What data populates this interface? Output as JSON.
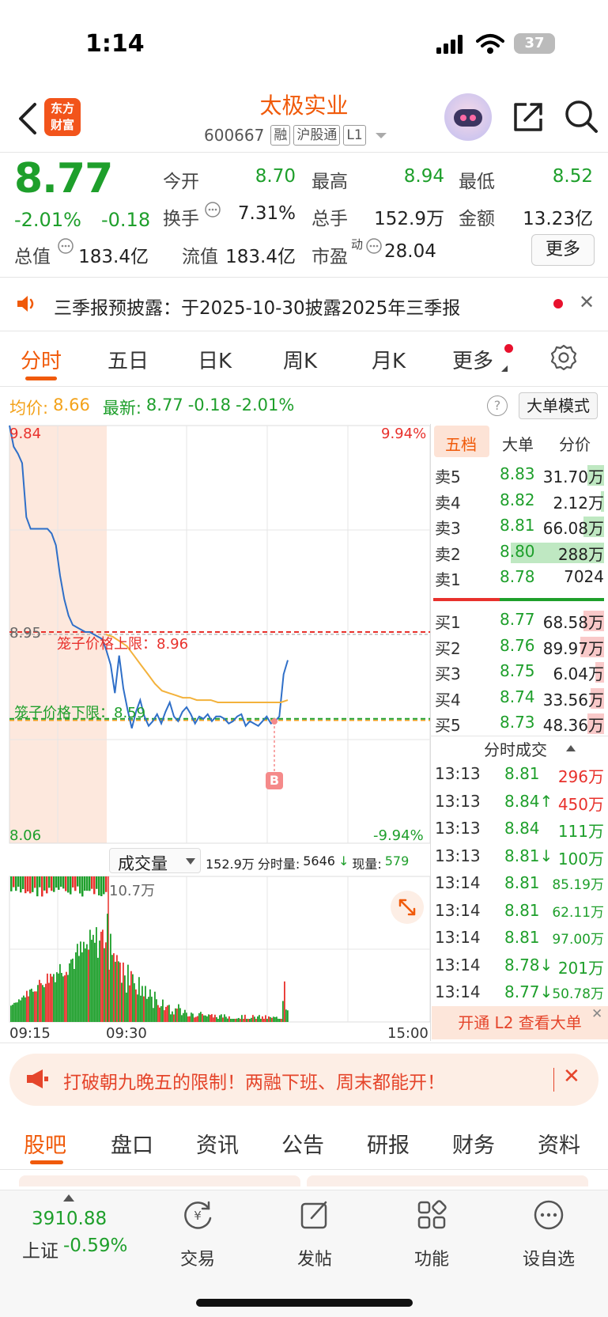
{
  "status": {
    "time": "1:14",
    "battery": "37"
  },
  "header": {
    "logo_line1": "东方",
    "logo_line2": "财富",
    "stock_name": "太极实业",
    "stock_code": "600667",
    "tags": [
      "融",
      "沪股通",
      "L1"
    ]
  },
  "quote": {
    "price": "8.77",
    "change_pct": "-2.01%",
    "change_amt": "-0.18",
    "fields": [
      {
        "label": "今开",
        "value": "8.70",
        "color": "#1e9f2b"
      },
      {
        "label": "最高",
        "value": "8.94",
        "color": "#1e9f2b"
      },
      {
        "label": "最低",
        "value": "8.52",
        "color": "#1e9f2b"
      },
      {
        "label": "换手",
        "value": "7.31%",
        "color": "#222222"
      },
      {
        "label": "总手",
        "value": "152.9万",
        "color": "#222222"
      },
      {
        "label": "金额",
        "value": "13.23亿",
        "color": "#222222"
      },
      {
        "label": "总值",
        "value": "183.4亿",
        "color": "#222222"
      },
      {
        "label": "流值",
        "value": "183.4亿",
        "color": "#222222"
      },
      {
        "label": "市盈",
        "sup": "动",
        "value": "28.04",
        "color": "#222222"
      }
    ],
    "more_label": "更多"
  },
  "notice": {
    "text": "三季报预披露：于2025-10-30披露2025年三季报"
  },
  "chart_tabs": [
    "分时",
    "五日",
    "日K",
    "周K",
    "月K",
    "更多"
  ],
  "info": {
    "avg_label": "均价:",
    "avg_value": "8.66",
    "latest_label": "最新:",
    "latest_value": "8.77",
    "latest_chg": "-0.18",
    "latest_pct": "-2.01%",
    "big_order_mode": "大单模式"
  },
  "chart_data": {
    "type": "line",
    "y_axis_left": {
      "top": "9.84",
      "mid": "8.95",
      "bottom": "8.06"
    },
    "y_axis_right": {
      "top": "9.94%",
      "bottom": "-9.94%"
    },
    "upper_limit_label": "笼子价格上限：8.96",
    "lower_limit_label": "笼子价格下限：8.59",
    "upper_limit": 8.96,
    "lower_limit": 8.59,
    "ylim": [
      8.06,
      9.84
    ],
    "marker": "B",
    "price_series": [
      9.84,
      9.75,
      9.72,
      9.68,
      9.45,
      9.4,
      9.4,
      9.4,
      9.4,
      9.4,
      9.38,
      9.33,
      9.2,
      9.1,
      9.03,
      8.99,
      8.98,
      8.97,
      8.96,
      8.96,
      8.95,
      8.94,
      8.93,
      8.88,
      8.82,
      8.7,
      8.86,
      8.72,
      8.63,
      8.55,
      8.62,
      8.67,
      8.6,
      8.56,
      8.58,
      8.61,
      8.57,
      8.62,
      8.66,
      8.6,
      8.58,
      8.62,
      8.64,
      8.61,
      8.57,
      8.6,
      8.59,
      8.61,
      8.58,
      8.6,
      8.6,
      8.59,
      8.57,
      8.58,
      8.6,
      8.61,
      8.56,
      8.58,
      8.57,
      8.56,
      8.58,
      8.6,
      8.57,
      8.58,
      8.6,
      8.78,
      8.84
    ],
    "avg_series": [
      8.95,
      8.94,
      8.92,
      8.9,
      8.86,
      8.82,
      8.78,
      8.74,
      8.71,
      8.7,
      8.69,
      8.68,
      8.68,
      8.67,
      8.67,
      8.67,
      8.66,
      8.66,
      8.66,
      8.66,
      8.66,
      8.66,
      8.66,
      8.66,
      8.66,
      8.66,
      8.67
    ],
    "volume_header": {
      "label": "成交量",
      "total": "152.9万",
      "period_label": "分时量:",
      "period_value": "5646",
      "current_label": "现量:",
      "current_value": "579"
    },
    "volume_max_label": "10.7万",
    "time_labels": [
      "09:15",
      "09:30",
      "15:00"
    ]
  },
  "order_book": {
    "tabs": [
      "五档",
      "大单",
      "分价"
    ],
    "asks": [
      {
        "label": "卖5",
        "price": "8.83",
        "volume": "31.70万",
        "bar": 0.1
      },
      {
        "label": "卖4",
        "price": "8.82",
        "volume": "2.12万",
        "bar": 0.02
      },
      {
        "label": "卖3",
        "price": "8.81",
        "volume": "66.08万",
        "bar": 0.12
      },
      {
        "label": "卖2",
        "price": "8.80",
        "volume": "288万",
        "bar": 0.55
      },
      {
        "label": "卖1",
        "price": "8.78",
        "volume": "7024",
        "bar": 0.0
      }
    ],
    "bids": [
      {
        "label": "买1",
        "price": "8.77",
        "volume": "68.58万",
        "bar": 0.12
      },
      {
        "label": "买2",
        "price": "8.76",
        "volume": "89.97万",
        "bar": 0.14
      },
      {
        "label": "买3",
        "price": "8.75",
        "volume": "6.04万",
        "bar": 0.05
      },
      {
        "label": "买4",
        "price": "8.74",
        "volume": "33.56万",
        "bar": 0.08
      },
      {
        "label": "买5",
        "price": "8.73",
        "volume": "48.36万",
        "bar": 0.1
      }
    ]
  },
  "ticks": {
    "title": "分时成交",
    "rows": [
      {
        "time": "13:13",
        "price": "8.81",
        "arrow": "",
        "volume": "296万",
        "vcolor": "#e8312c"
      },
      {
        "time": "13:13",
        "price": "8.84",
        "arrow": "↑",
        "volume": "450万",
        "vcolor": "#e8312c"
      },
      {
        "time": "13:13",
        "price": "8.84",
        "arrow": "",
        "volume": "111万",
        "vcolor": "#1e9f2b"
      },
      {
        "time": "13:13",
        "price": "8.81",
        "arrow": "↓",
        "volume": "100万",
        "vcolor": "#1e9f2b"
      },
      {
        "time": "13:14",
        "price": "8.81",
        "arrow": "",
        "volume": "85.19万",
        "vcolor": "#1e9f2b"
      },
      {
        "time": "13:14",
        "price": "8.81",
        "arrow": "",
        "volume": "62.11万",
        "vcolor": "#1e9f2b"
      },
      {
        "time": "13:14",
        "price": "8.81",
        "arrow": "",
        "volume": "97.00万",
        "vcolor": "#1e9f2b"
      },
      {
        "time": "13:14",
        "price": "8.78",
        "arrow": "↓",
        "volume": "201万",
        "vcolor": "#1e9f2b"
      },
      {
        "time": "13:14",
        "price": "8.77",
        "arrow": "↓",
        "volume": "50.78万",
        "vcolor": "#1e9f2b"
      }
    ],
    "l2_label": "开通 L2 查看大单"
  },
  "promo": {
    "text": "打破朝九晚五的限制！两融下班、周末都能开！"
  },
  "section_tabs": [
    "股吧",
    "盘口",
    "资讯",
    "公告",
    "研报",
    "财务",
    "资料"
  ],
  "bottom_nav": {
    "index_value": "3910.88",
    "index_label": "上证",
    "index_pct": "-0.59%",
    "items": [
      "交易",
      "发帖",
      "功能",
      "设自选"
    ]
  },
  "colors": {
    "accent": "#f05a0a",
    "up": "#e8312c",
    "down": "#1e9f2b",
    "price_line": "#2f6fc8",
    "avg_line": "#f3b23c"
  }
}
